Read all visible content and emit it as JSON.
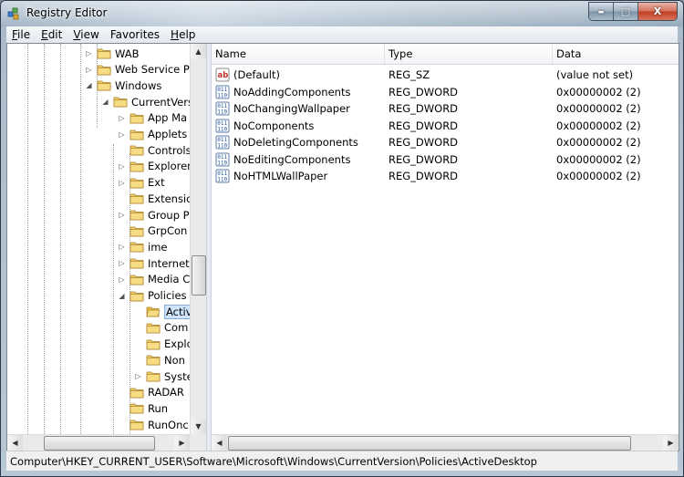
{
  "window": {
    "title": "Registry Editor",
    "controls": {
      "minimize": "▬",
      "maximize": "□",
      "close": "X"
    }
  },
  "menu": [
    {
      "label": "File",
      "key": "F",
      "rest": "ile"
    },
    {
      "label": "Edit",
      "key": "E",
      "rest": "dit"
    },
    {
      "label": "View",
      "key": "V",
      "rest": "iew"
    },
    {
      "label": "Favorites",
      "key": "",
      "rest": "Favorites"
    },
    {
      "label": "Help",
      "key": "H",
      "rest": "elp"
    }
  ],
  "tree": {
    "nodes": [
      {
        "label": "WAB",
        "expander": "collapsed"
      },
      {
        "label": "Web Service Pro",
        "expander": "collapsed"
      },
      {
        "label": "Windows",
        "expander": "expanded"
      },
      {
        "label": "CurrentVersi",
        "expander": "expanded"
      },
      {
        "label": "App Ma",
        "expander": "collapsed"
      },
      {
        "label": "Applets",
        "expander": "collapsed"
      },
      {
        "label": "Controls",
        "expander": "none"
      },
      {
        "label": "Explorer",
        "expander": "collapsed"
      },
      {
        "label": "Ext",
        "expander": "collapsed"
      },
      {
        "label": "Extensio",
        "expander": "none"
      },
      {
        "label": "Group P",
        "expander": "collapsed"
      },
      {
        "label": "GrpCon",
        "expander": "none"
      },
      {
        "label": "ime",
        "expander": "collapsed"
      },
      {
        "label": "Internet",
        "expander": "collapsed"
      },
      {
        "label": "Media C",
        "expander": "collapsed"
      },
      {
        "label": "Policies",
        "expander": "expanded"
      },
      {
        "label": "Activ",
        "expander": "none",
        "selected": true
      },
      {
        "label": "Com",
        "expander": "none"
      },
      {
        "label": "Explo",
        "expander": "none"
      },
      {
        "label": "Non",
        "expander": "none"
      },
      {
        "label": "Syste",
        "expander": "collapsed"
      },
      {
        "label": "RADAR",
        "expander": "none"
      },
      {
        "label": "Run",
        "expander": "none"
      },
      {
        "label": "RunOnc",
        "expander": "none"
      }
    ],
    "scroll_glyphs": {
      "up": "▲",
      "down": "▼",
      "left": "◀",
      "right": "▶"
    }
  },
  "list": {
    "columns": [
      "Name",
      "Type",
      "Data"
    ],
    "rows": [
      {
        "name": "(Default)",
        "type": "REG_SZ",
        "data": "(value not set)",
        "icon": "string-value-icon"
      },
      {
        "name": "NoAddingComponents",
        "type": "REG_DWORD",
        "data": "0x00000002 (2)",
        "icon": "binary-value-icon"
      },
      {
        "name": "NoChangingWallpaper",
        "type": "REG_DWORD",
        "data": "0x00000002 (2)",
        "icon": "binary-value-icon"
      },
      {
        "name": "NoComponents",
        "type": "REG_DWORD",
        "data": "0x00000002 (2)",
        "icon": "binary-value-icon"
      },
      {
        "name": "NoDeletingComponents",
        "type": "REG_DWORD",
        "data": "0x00000002 (2)",
        "icon": "binary-value-icon"
      },
      {
        "name": "NoEditingComponents",
        "type": "REG_DWORD",
        "data": "0x00000002 (2)",
        "icon": "binary-value-icon"
      },
      {
        "name": "NoHTMLWallPaper",
        "type": "REG_DWORD",
        "data": "0x00000002 (2)",
        "icon": "binary-value-icon"
      }
    ]
  },
  "status_bar": {
    "path": "Computer\\HKEY_CURRENT_USER\\Software\\Microsoft\\Windows\\CurrentVersion\\Policies\\ActiveDesktop"
  },
  "colors": {
    "selection": "#cfe3fa",
    "folder": "#f2cf6a",
    "close": "#c13c22"
  }
}
